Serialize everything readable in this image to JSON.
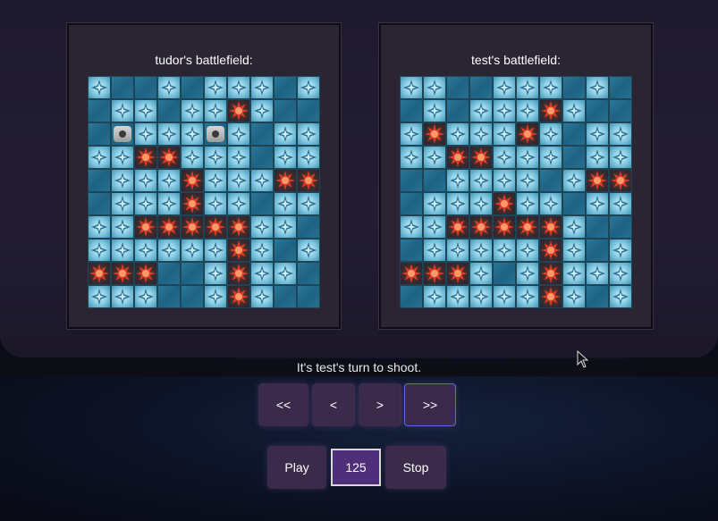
{
  "boards": [
    {
      "title": "tudor's battlefield:",
      "grid": [
        [
          "M",
          "W",
          "W",
          "M",
          "W",
          "M",
          "M",
          "M",
          "W",
          "M"
        ],
        [
          "W",
          "M",
          "M",
          "W",
          "M",
          "M",
          "H",
          "M",
          "W",
          "W"
        ],
        [
          "W",
          "S",
          "M",
          "M",
          "M",
          "S",
          "M",
          "W",
          "M",
          "M"
        ],
        [
          "M",
          "M",
          "H",
          "H",
          "M",
          "M",
          "M",
          "W",
          "M",
          "M"
        ],
        [
          "W",
          "M",
          "M",
          "M",
          "H",
          "M",
          "M",
          "M",
          "H",
          "H"
        ],
        [
          "W",
          "M",
          "M",
          "M",
          "H",
          "M",
          "M",
          "W",
          "M",
          "M"
        ],
        [
          "M",
          "M",
          "H",
          "H",
          "H",
          "H",
          "H",
          "M",
          "M",
          "W"
        ],
        [
          "M",
          "M",
          "M",
          "M",
          "M",
          "M",
          "H",
          "M",
          "W",
          "M"
        ],
        [
          "H",
          "H",
          "H",
          "W",
          "W",
          "M",
          "H",
          "M",
          "M",
          "W"
        ],
        [
          "M",
          "M",
          "M",
          "W",
          "W",
          "M",
          "H",
          "M",
          "W",
          "W"
        ]
      ]
    },
    {
      "title": "test's battlefield:",
      "grid": [
        [
          "M",
          "M",
          "W",
          "W",
          "M",
          "M",
          "M",
          "W",
          "M",
          "W"
        ],
        [
          "W",
          "M",
          "W",
          "M",
          "M",
          "M",
          "H",
          "M",
          "W",
          "W"
        ],
        [
          "M",
          "H",
          "M",
          "M",
          "M",
          "H",
          "M",
          "W",
          "M",
          "M"
        ],
        [
          "M",
          "M",
          "H",
          "H",
          "M",
          "M",
          "M",
          "W",
          "M",
          "M"
        ],
        [
          "W",
          "W",
          "M",
          "M",
          "M",
          "M",
          "W",
          "M",
          "H",
          "H"
        ],
        [
          "W",
          "M",
          "M",
          "M",
          "H",
          "M",
          "M",
          "W",
          "M",
          "M"
        ],
        [
          "M",
          "M",
          "H",
          "H",
          "H",
          "H",
          "H",
          "M",
          "W",
          "W"
        ],
        [
          "W",
          "M",
          "M",
          "M",
          "M",
          "M",
          "H",
          "M",
          "W",
          "M"
        ],
        [
          "H",
          "H",
          "H",
          "M",
          "W",
          "M",
          "H",
          "M",
          "M",
          "M"
        ],
        [
          "W",
          "M",
          "M",
          "M",
          "M",
          "M",
          "H",
          "M",
          "W",
          "M"
        ]
      ]
    }
  ],
  "status": {
    "turn_text": "It's test's turn to shoot."
  },
  "nav": {
    "first_label": "<<",
    "prev_label": "<",
    "next_label": ">",
    "last_label": ">>"
  },
  "playback": {
    "play_label": "Play",
    "speed_value": "125",
    "stop_label": "Stop"
  },
  "colors": {
    "accent": "#5a6bd6",
    "button_bg": "#3b2b4a",
    "counter_bg": "#4f2e7a",
    "hit": "#e53b24",
    "water": "#1f6283"
  }
}
